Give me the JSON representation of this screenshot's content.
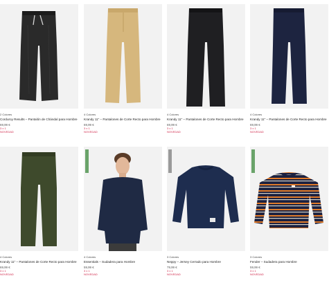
{
  "products": [
    {
      "colors": "2 Colores",
      "title": "Corduroy Results – Pantalón de Chándal para Hombre",
      "price": "69,99 €",
      "promo1": "3 x 1",
      "promo2": "NOVEDAD"
    },
    {
      "colors": "4 Colores",
      "title": "Krandy 11\" – Pantalones de Corte Recto para Hombre",
      "price": "69,99 €",
      "promo1": "3 x 1",
      "promo2": "NOVEDAD"
    },
    {
      "colors": "4 Colores",
      "title": "Krandy 11\" – Pantalones de Corte Recto para Hombre",
      "price": "69,99 €",
      "promo1": "3 x 1",
      "promo2": "NOVEDAD"
    },
    {
      "colors": "4 Colores",
      "title": "Krandy 11\" – Pantalones de Corte Recto para Hombre",
      "price": "69,99 €",
      "promo1": "3 x 1",
      "promo2": "NOVEDAD"
    },
    {
      "colors": "4 Colores",
      "title": "Krandy 11\" – Pantalones de Corte Recto para Hombre",
      "price": "69,99 €",
      "promo1": "3 x 1",
      "promo2": "NOVEDAD"
    },
    {
      "colors": "4 Colores",
      "title": "Essentials – Sudadera para Hombre",
      "price": "59,99 €",
      "promo1": "3 x 1",
      "promo2": "NOVEDAD"
    },
    {
      "colors": "3 Colores",
      "title": "Neppy – Jersey Cerrado para Hombre",
      "price": "79,99 €",
      "promo1": "3 x 1",
      "promo2": "NOVEDAD"
    },
    {
      "colors": "3 Colores",
      "title": "Fender – Sudadera para Hombre",
      "price": "59,99 €",
      "promo1": "3 x 1",
      "promo2": "NOVEDAD"
    }
  ],
  "colors": {
    "promo": "#d0284b",
    "badge_green": "#6aa36a",
    "card_bg": "#f2f2f2"
  }
}
